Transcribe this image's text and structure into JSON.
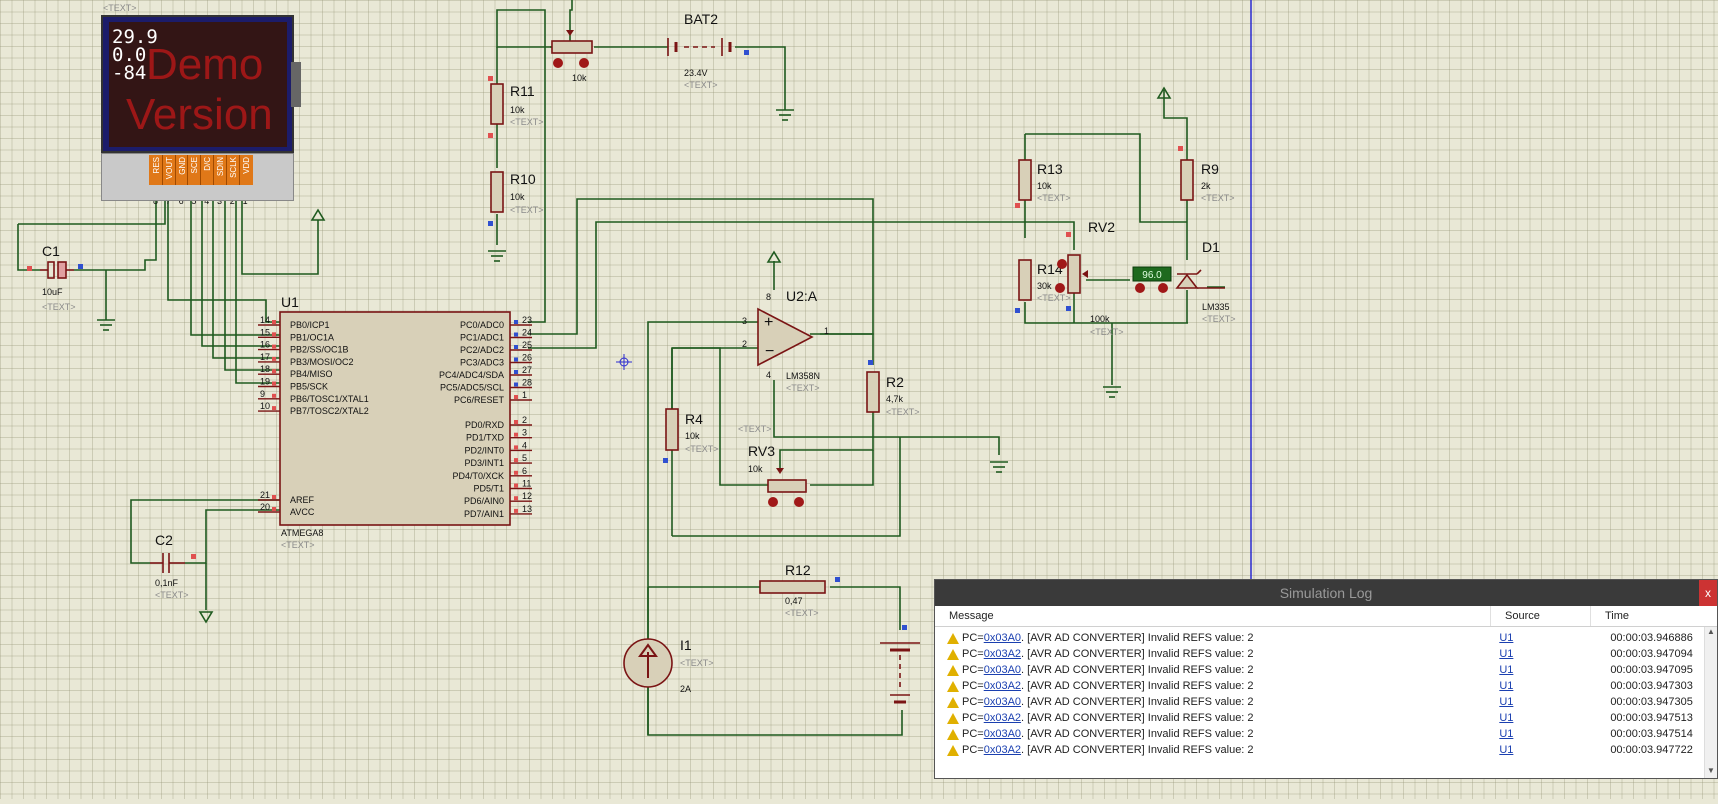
{
  "lcd": {
    "lines": [
      "29.9",
      "0.0",
      "-84"
    ],
    "watermark": [
      "Demo",
      "Version"
    ],
    "pins": [
      "RES",
      "VOUT",
      "GND",
      "SCE",
      "D/C",
      "SDIN",
      "SCLK",
      "VDD"
    ],
    "pin_numbers": [
      "8",
      "7",
      "6",
      "5",
      "4",
      "3",
      "2",
      "1"
    ]
  },
  "parts": {
    "c1": {
      "ref": "C1",
      "value": "10uF",
      "text": "<TEXT>"
    },
    "c2": {
      "ref": "C2",
      "value": "0,1nF",
      "text": "<TEXT>"
    },
    "u1": {
      "ref": "U1",
      "part": "ATMEGA8",
      "text": "<TEXT>"
    },
    "r11": {
      "ref": "R11",
      "value": "10k",
      "text": "<TEXT>"
    },
    "r10": {
      "ref": "R10",
      "value": "10k",
      "text": "<TEXT>"
    },
    "bat2": {
      "ref": "BAT2",
      "value": "23.4V",
      "text": "<TEXT>"
    },
    "pot_top": {
      "value": "10k"
    },
    "u2": {
      "ref": "U2:A",
      "part": "LM358N",
      "text": "<TEXT>",
      "pin_plus": "3",
      "pin_minus": "2",
      "pin_out": "1",
      "pin_v": "8",
      "pin_g": "4"
    },
    "r2": {
      "ref": "R2",
      "value": "4,7k",
      "text": "<TEXT>"
    },
    "r4": {
      "ref": "R4",
      "value": "10k",
      "text": "<TEXT>"
    },
    "rv3": {
      "ref": "RV3",
      "value": "10k",
      "text": "<TEXT>",
      "extra": "<TEXT>"
    },
    "r12": {
      "ref": "R12",
      "value": "0,47",
      "text": "<TEXT>"
    },
    "i1": {
      "ref": "I1",
      "value": "2A",
      "text": "<TEXT>"
    },
    "r13": {
      "ref": "R13",
      "value": "10k",
      "text": "<TEXT>"
    },
    "r14": {
      "ref": "R14",
      "value": "30k",
      "text": "<TEXT>"
    },
    "rv2": {
      "ref": "RV2",
      "value": "100k",
      "text": "<TEXT>"
    },
    "r9": {
      "ref": "R9",
      "value": "2k",
      "text": "<TEXT>"
    },
    "d1": {
      "ref": "D1",
      "part": "LM335",
      "text": "<TEXT>",
      "readout": "96.0"
    },
    "lcd_text": "<TEXT>"
  },
  "u1_left_pins": [
    {
      "num": "14",
      "name": "PB0/ICP1"
    },
    {
      "num": "15",
      "name": "PB1/OC1A"
    },
    {
      "num": "16",
      "name": "PB2/SS/OC1B"
    },
    {
      "num": "17",
      "name": "PB3/MOSI/OC2"
    },
    {
      "num": "18",
      "name": "PB4/MISO"
    },
    {
      "num": "19",
      "name": "PB5/SCK"
    },
    {
      "num": "9",
      "name": "PB6/TOSC1/XTAL1"
    },
    {
      "num": "10",
      "name": "PB7/TOSC2/XTAL2"
    }
  ],
  "u1_left_pins2": [
    {
      "num": "21",
      "name": "AREF"
    },
    {
      "num": "20",
      "name": "AVCC"
    }
  ],
  "u1_right_pins": [
    {
      "num": "23",
      "name": "PC0/ADC0"
    },
    {
      "num": "24",
      "name": "PC1/ADC1"
    },
    {
      "num": "25",
      "name": "PC2/ADC2"
    },
    {
      "num": "26",
      "name": "PC3/ADC3"
    },
    {
      "num": "27",
      "name": "PC4/ADC4/SDA"
    },
    {
      "num": "28",
      "name": "PC5/ADC5/SCL"
    },
    {
      "num": "1",
      "name": "PC6/RESET"
    },
    {
      "num": "2",
      "name": "PD0/RXD"
    },
    {
      "num": "3",
      "name": "PD1/TXD"
    },
    {
      "num": "4",
      "name": "PD2/INT0"
    },
    {
      "num": "5",
      "name": "PD3/INT1"
    },
    {
      "num": "6",
      "name": "PD4/T0/XCK"
    },
    {
      "num": "11",
      "name": "PD5/T1"
    },
    {
      "num": "12",
      "name": "PD6/AIN0"
    },
    {
      "num": "13",
      "name": "PD7/AIN1"
    }
  ],
  "simlog": {
    "title": "Simulation Log",
    "close": "x",
    "columns": [
      "Message",
      "Source",
      "Time"
    ],
    "rows": [
      {
        "pc_pre": "PC=",
        "addr": "0x03A0",
        "msg": ". [AVR AD CONVERTER] Invalid REFS value: 2",
        "src": "U1",
        "time": "00:00:03.946886"
      },
      {
        "pc_pre": "PC=",
        "addr": "0x03A2",
        "msg": ". [AVR AD CONVERTER] Invalid REFS value: 2",
        "src": "U1",
        "time": "00:00:03.947094"
      },
      {
        "pc_pre": "PC=",
        "addr": "0x03A0",
        "msg": ". [AVR AD CONVERTER] Invalid REFS value: 2",
        "src": "U1",
        "time": "00:00:03.947095"
      },
      {
        "pc_pre": "PC=",
        "addr": "0x03A2",
        "msg": ". [AVR AD CONVERTER] Invalid REFS value: 2",
        "src": "U1",
        "time": "00:00:03.947303"
      },
      {
        "pc_pre": "PC=",
        "addr": "0x03A0",
        "msg": ". [AVR AD CONVERTER] Invalid REFS value: 2",
        "src": "U1",
        "time": "00:00:03.947305"
      },
      {
        "pc_pre": "PC=",
        "addr": "0x03A2",
        "msg": ". [AVR AD CONVERTER] Invalid REFS value: 2",
        "src": "U1",
        "time": "00:00:03.947513"
      },
      {
        "pc_pre": "PC=",
        "addr": "0x03A0",
        "msg": ". [AVR AD CONVERTER] Invalid REFS value: 2",
        "src": "U1",
        "time": "00:00:03.947514"
      },
      {
        "pc_pre": "PC=",
        "addr": "0x03A2",
        "msg": ". [AVR AD CONVERTER] Invalid REFS value: 2",
        "src": "U1",
        "time": "00:00:03.947722"
      }
    ]
  },
  "colors": {
    "wire": "#1f5a1f",
    "part_outline": "#7a1414",
    "background": "#e9e8d6",
    "warning": "#e0b000",
    "link": "#1a3fb0"
  }
}
